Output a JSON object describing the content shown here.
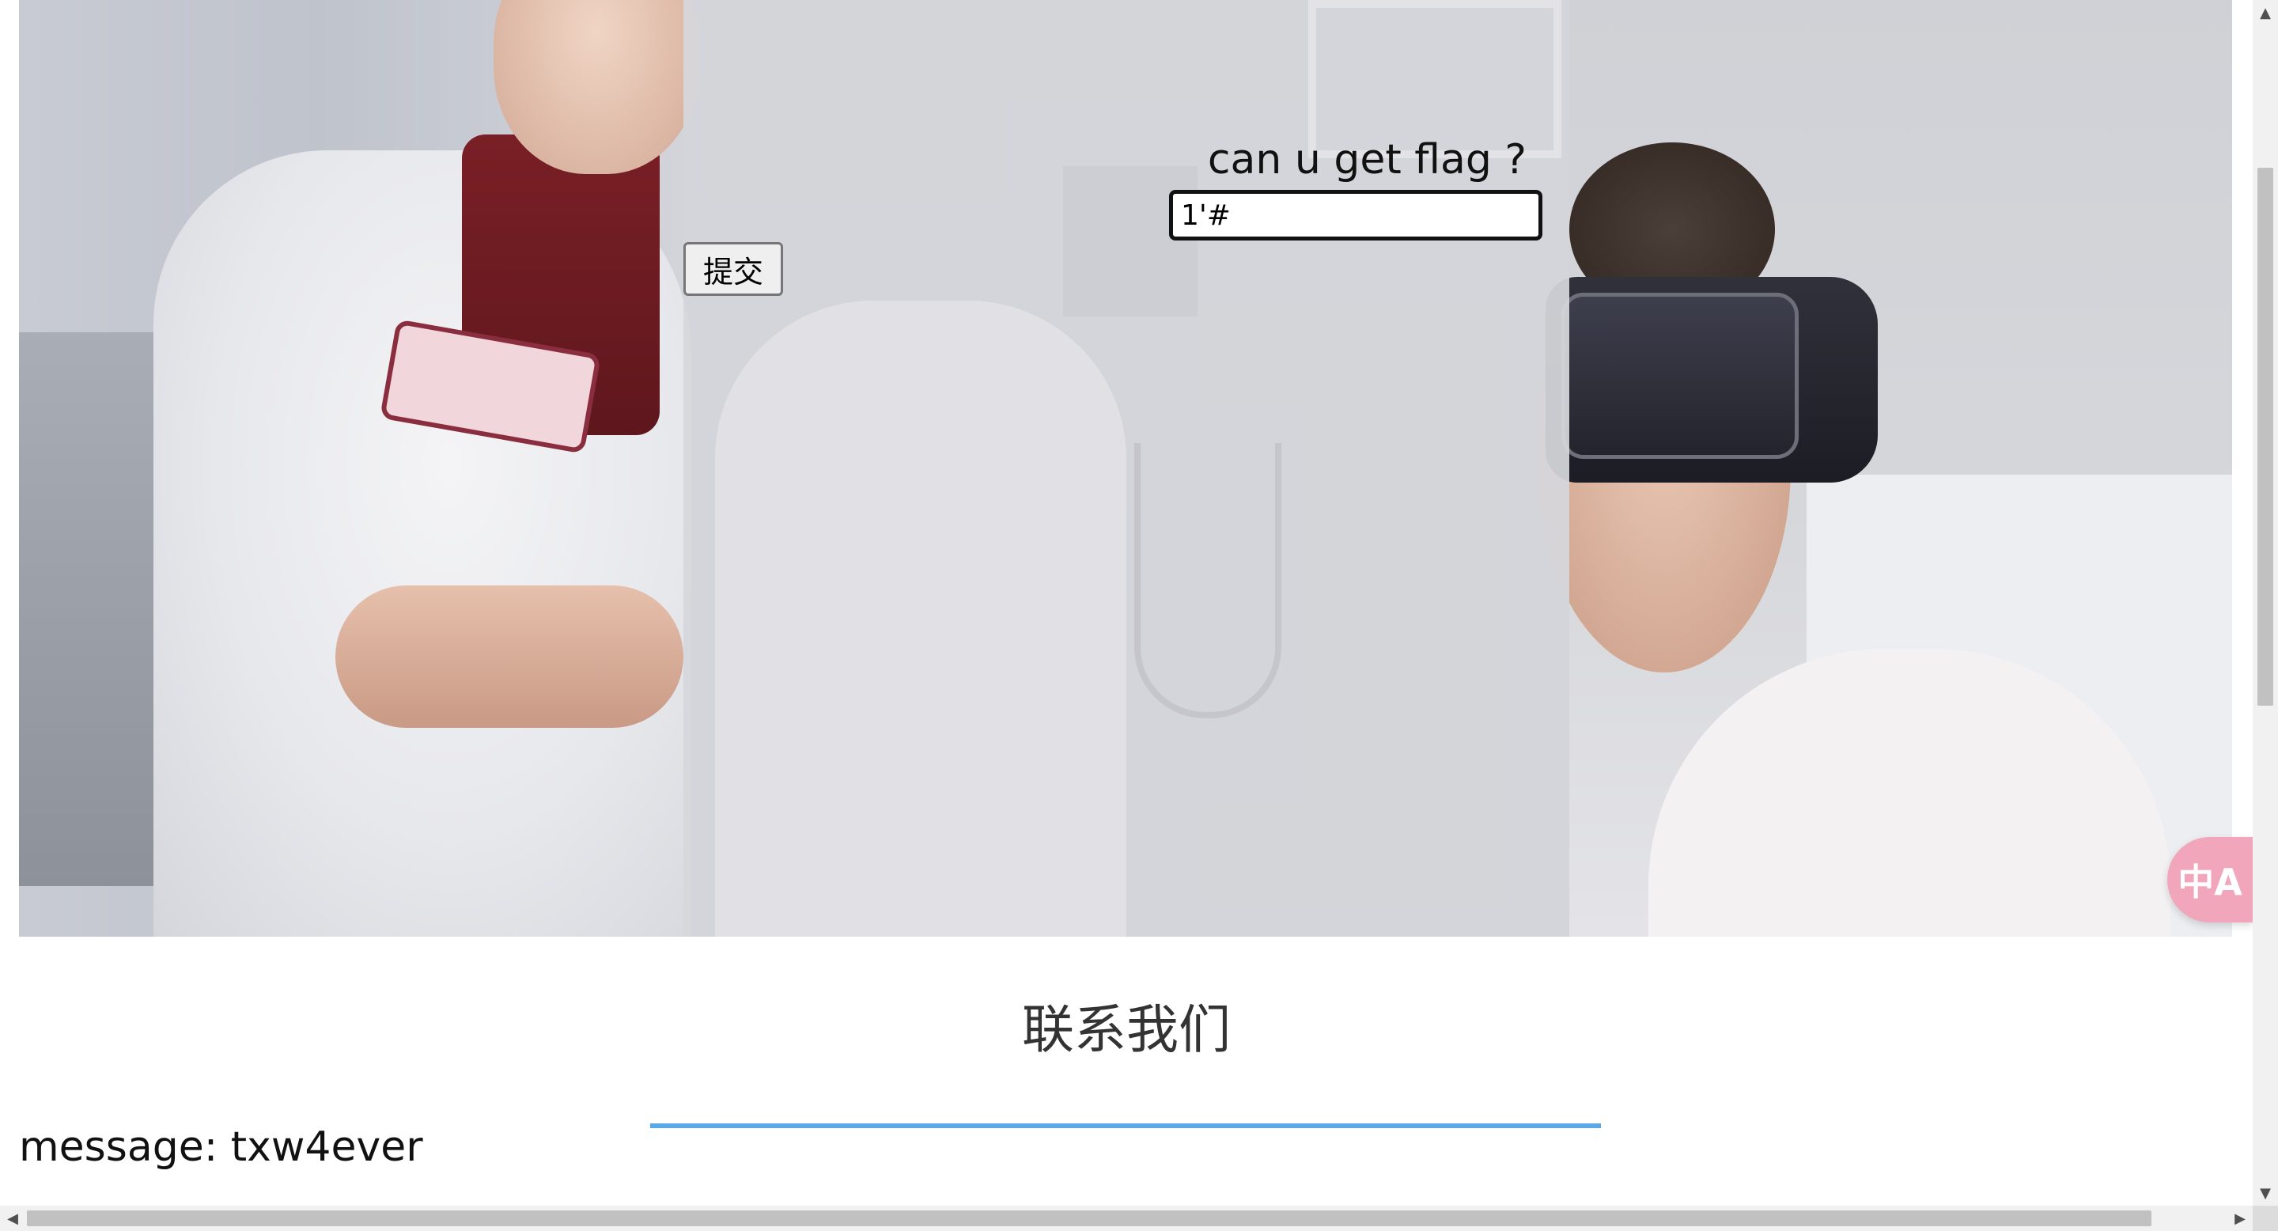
{
  "challenge": {
    "prompt_label": "can u get flag ?",
    "input_value": "1'#",
    "submit_label": "提交"
  },
  "contact": {
    "title": "联系我们",
    "message_line": "message: txw4ever"
  },
  "translate_button": {
    "icon": "translate-icon",
    "glyph": "中A",
    "color": "#f2a6bc"
  },
  "scrollbars": {
    "up_glyph": "▲",
    "down_glyph": "▼",
    "left_glyph": "◀",
    "right_glyph": "▶"
  },
  "colors": {
    "underline": "#5aa9e6",
    "overlay": "#d6d7db"
  }
}
